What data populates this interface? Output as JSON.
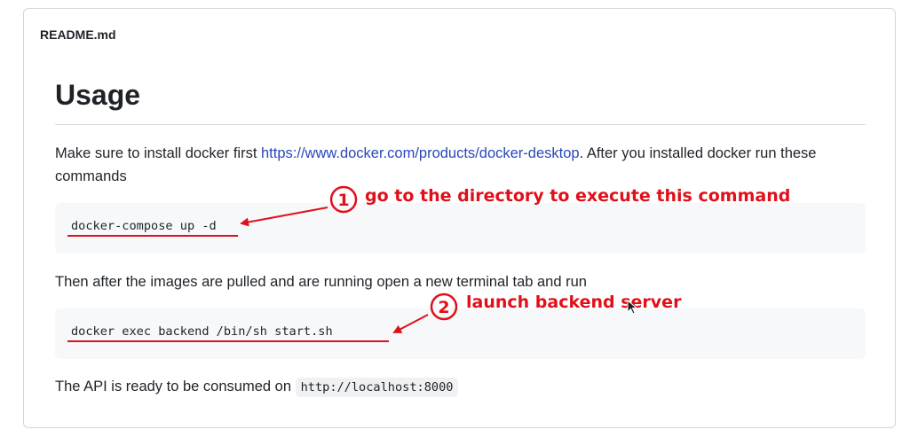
{
  "readme": {
    "filename": "README.md",
    "heading": "Usage",
    "intro_before_link": "Make sure to install docker first ",
    "intro_link": "https://www.docker.com/products/docker-desktop",
    "intro_after_link": ". After you installed docker run these commands",
    "code_block_1": "docker-compose up -d",
    "middle_text": "Then after the images are pulled and are running open a new terminal tab and run",
    "code_block_2": "docker exec backend /bin/sh start.sh",
    "api_text": "The API is ready to be consumed on ",
    "api_url": "http://localhost:8000"
  },
  "annotations": {
    "color": "#e0101a",
    "step1_number": "1",
    "step1_text": "go to the directory to execute this command",
    "step2_number": "2",
    "step2_text": "launch backend server"
  }
}
